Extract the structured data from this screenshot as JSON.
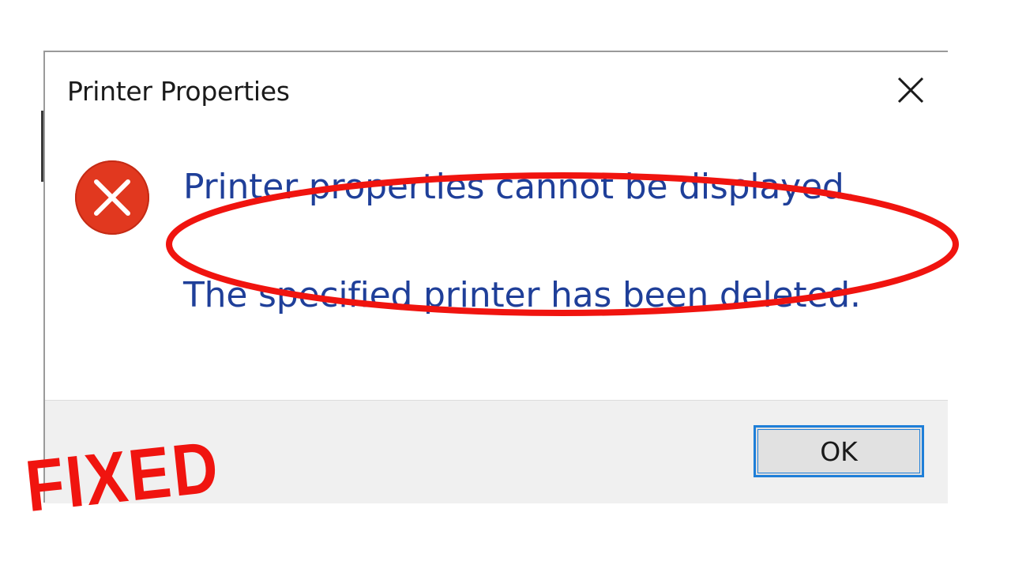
{
  "dialog": {
    "title": "Printer Properties",
    "message_main": "Printer properties cannot be displayed.",
    "message_detail": "The specified printer has been deleted.",
    "ok_label": "OK",
    "icons": {
      "close": "close-icon",
      "error": "error-icon"
    }
  },
  "overlay": {
    "stamp_text": "FIXED",
    "highlight": "red-ellipse"
  },
  "colors": {
    "message_text": "#1f3f99",
    "error_icon": "#e1381f",
    "ok_focus_border": "#1f7fd8",
    "annotation_red": "#f0140f",
    "footer_bg": "#f0f0f0"
  }
}
